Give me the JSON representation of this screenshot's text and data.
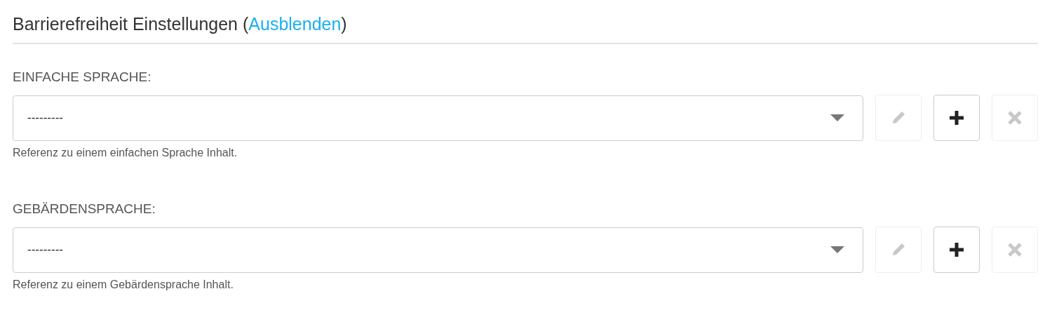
{
  "heading": {
    "title": "Barrierefreiheit Einstellungen",
    "open_paren": "(",
    "link": "Ausblenden",
    "close_paren": ")"
  },
  "fields": [
    {
      "label": "EINFACHE SPRACHE:",
      "value": "---------",
      "help": "Referenz zu einem einfachen Sprache Inhalt.",
      "buttons": [
        {
          "kind": "edit",
          "disabled": true
        },
        {
          "kind": "add",
          "disabled": false
        },
        {
          "kind": "delete",
          "disabled": true
        }
      ]
    },
    {
      "label": "GEBÄRDENSPRACHE:",
      "value": "---------",
      "help": "Referenz zu einem Gebärdensprache Inhalt.",
      "buttons": [
        {
          "kind": "edit",
          "disabled": true
        },
        {
          "kind": "add",
          "disabled": false
        },
        {
          "kind": "delete",
          "disabled": true
        }
      ]
    }
  ]
}
